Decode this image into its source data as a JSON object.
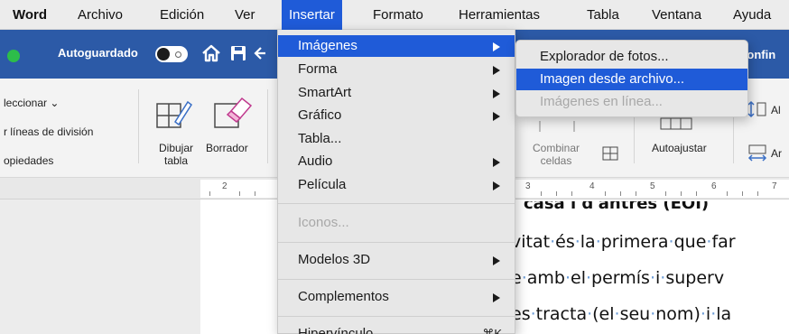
{
  "menubar": {
    "app": "Word",
    "items": [
      "Archivo",
      "Edición",
      "Ver",
      "Insertar",
      "Formato",
      "Herramientas",
      "Tabla",
      "Ventana",
      "Ayuda"
    ]
  },
  "titlebar": {
    "autosave_label": "Autoguardado",
    "autosave_on": false,
    "right_text": "Confin",
    "icons": [
      "home-icon",
      "save-icon",
      "back-arrow-icon"
    ],
    "color": "#2c5aa7"
  },
  "ribbon": {
    "left_items": [
      "leccionar ⌄",
      "r líneas de división",
      "opiedades"
    ],
    "draw_table_label": "Dibujar tabla",
    "draw_table_line1": "Dibujar",
    "draw_table_line2": "tabla",
    "eraser_label": "Borrador",
    "merge_line1": "Combinar",
    "merge_line2": "celdas",
    "autofit_label": "Autoajustar",
    "al_label": "Al",
    "ar_label": "Ar"
  },
  "ruler": {
    "numbers": [
      "2",
      "3",
      "4",
      "5",
      "6",
      "7"
    ]
  },
  "document": {
    "top_text": "casa i d'antres (EOI)",
    "lines": [
      [
        "vitat",
        "és",
        "la",
        "primera",
        "que",
        "far"
      ],
      [
        "e",
        "amb",
        "el",
        "permís",
        "i",
        "superv"
      ],
      [
        "es",
        "tracta",
        "(el",
        "seu",
        "nom)",
        "i",
        "la"
      ]
    ]
  },
  "insert_menu": {
    "items": [
      {
        "label": "Imágenes",
        "submenu": true,
        "highlighted": true
      },
      {
        "label": "Forma",
        "submenu": true
      },
      {
        "label": "SmartArt",
        "submenu": true
      },
      {
        "label": "Gráfico",
        "submenu": true
      },
      {
        "label": "Tabla...",
        "submenu": false
      },
      {
        "label": "Audio",
        "submenu": true
      },
      {
        "label": "Película",
        "submenu": true
      },
      {
        "label": "Iconos...",
        "disabled": true
      },
      {
        "label": "Modelos 3D",
        "submenu": true
      },
      {
        "label": "Complementos",
        "submenu": true
      },
      {
        "label": "Hipervínculo",
        "shortcut": "⌘K"
      }
    ]
  },
  "images_submenu": {
    "items": [
      {
        "label": "Explorador de fotos..."
      },
      {
        "label": "Imagen desde archivo...",
        "highlighted": true
      },
      {
        "label": "Imágenes en línea...",
        "disabled": true
      }
    ]
  },
  "colors": {
    "highlight": "#1f5bd8",
    "menu_bg": "#e7e7e7"
  }
}
